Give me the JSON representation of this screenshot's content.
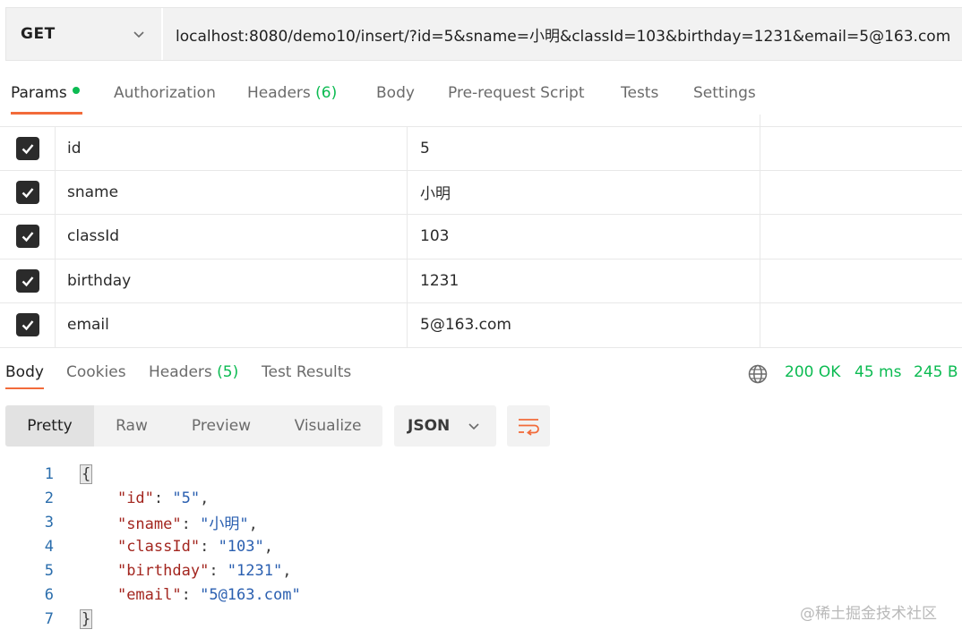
{
  "request": {
    "method": "GET",
    "url": "localhost:8080/demo10/insert/?id=5&sname=小明&classId=103&birthday=1231&email=5@163.com"
  },
  "request_tabs": [
    {
      "label": "Params",
      "count": ""
    },
    {
      "label": "Authorization",
      "count": ""
    },
    {
      "label": "Headers",
      "count": "(6)"
    },
    {
      "label": "Body",
      "count": ""
    },
    {
      "label": "Pre-request Script",
      "count": ""
    },
    {
      "label": "Tests",
      "count": ""
    },
    {
      "label": "Settings",
      "count": ""
    }
  ],
  "params": [
    {
      "key": "id",
      "value": "5",
      "checked": true
    },
    {
      "key": "sname",
      "value": "小明",
      "checked": true
    },
    {
      "key": "classId",
      "value": "103",
      "checked": true
    },
    {
      "key": "birthday",
      "value": "1231",
      "checked": true
    },
    {
      "key": "email",
      "value": "5@163.com",
      "checked": true
    }
  ],
  "response_tabs": [
    {
      "label": "Body",
      "count": ""
    },
    {
      "label": "Cookies",
      "count": ""
    },
    {
      "label": "Headers",
      "count": "(5)"
    },
    {
      "label": "Test Results",
      "count": ""
    }
  ],
  "response_status": {
    "status": "200 OK",
    "time": "45 ms",
    "size": "245 B"
  },
  "format_buttons": [
    "Pretty",
    "Raw",
    "Preview",
    "Visualize"
  ],
  "language": "JSON",
  "code": {
    "line_numbers": [
      "1",
      "2",
      "3",
      "4",
      "5",
      "6",
      "7"
    ],
    "open_brace": "{",
    "close_brace": "}",
    "fields": [
      {
        "key": "\"id\"",
        "value": "\"5\"",
        "sep": ","
      },
      {
        "key": "\"sname\"",
        "value": "\"小明\"",
        "sep": ","
      },
      {
        "key": "\"classId\"",
        "value": "\"103\"",
        "sep": ","
      },
      {
        "key": "\"birthday\"",
        "value": "\"1231\"",
        "sep": ","
      },
      {
        "key": "\"email\"",
        "value": "\"5@163.com\"",
        "sep": ""
      }
    ]
  },
  "watermark": "@稀土掘金技术社区",
  "colors": {
    "accent": "#f26b3a",
    "success": "#0cbb52"
  }
}
